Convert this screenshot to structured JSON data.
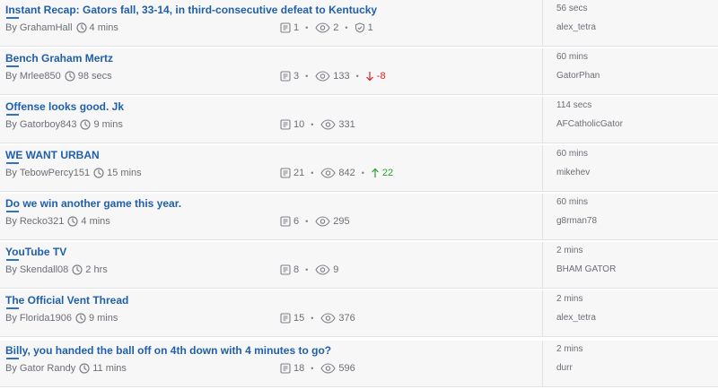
{
  "by_label": "By",
  "threads": [
    {
      "title": "Instant Recap: Gators fall, 33-14, in third-consecutive defeat to Kentucky",
      "author": "GrahamHall",
      "age": "4 mins",
      "replies": "1",
      "views": "2",
      "shield": "1",
      "last_time": "56 secs",
      "last_user": "alex_tetra"
    },
    {
      "title": "Bench Graham Mertz",
      "author": "Mrlee850",
      "age": "98 secs",
      "replies": "3",
      "views": "133",
      "vote": "-8",
      "vote_dir": "down",
      "last_time": "60 mins",
      "last_user": "GatorPhan"
    },
    {
      "title": "Offense looks good. Jk",
      "author": "Gatorboy843",
      "age": "9 mins",
      "replies": "10",
      "views": "331",
      "last_time": "114 secs",
      "last_user": "AFCatholicGator"
    },
    {
      "title": "WE WANT URBAN",
      "author": "TebowPercy151",
      "age": "15 mins",
      "replies": "21",
      "views": "842",
      "vote": "22",
      "vote_dir": "up",
      "last_time": "60 mins",
      "last_user": "mikehev"
    },
    {
      "title": "Do we win another game this year.",
      "author": "Recko321",
      "age": "4 mins",
      "replies": "6",
      "views": "295",
      "last_time": "60 mins",
      "last_user": "g8rman78"
    },
    {
      "title": "YouTube TV",
      "author": "Skendall08",
      "age": "2 hrs",
      "replies": "8",
      "views": "9",
      "last_time": "2 mins",
      "last_user": "BHAM GATOR"
    },
    {
      "title": "The Official Vent Thread",
      "author": "Florida1906",
      "age": "9 mins",
      "replies": "15",
      "views": "376",
      "last_time": "2 mins",
      "last_user": "alex_tetra"
    },
    {
      "title": "Billy, you handed the ball off on 4th down with 4 minutes to go?",
      "author": "Gator Randy",
      "age": "11 mins",
      "replies": "18",
      "views": "596",
      "last_time": "2 mins",
      "last_user": "durr"
    }
  ]
}
